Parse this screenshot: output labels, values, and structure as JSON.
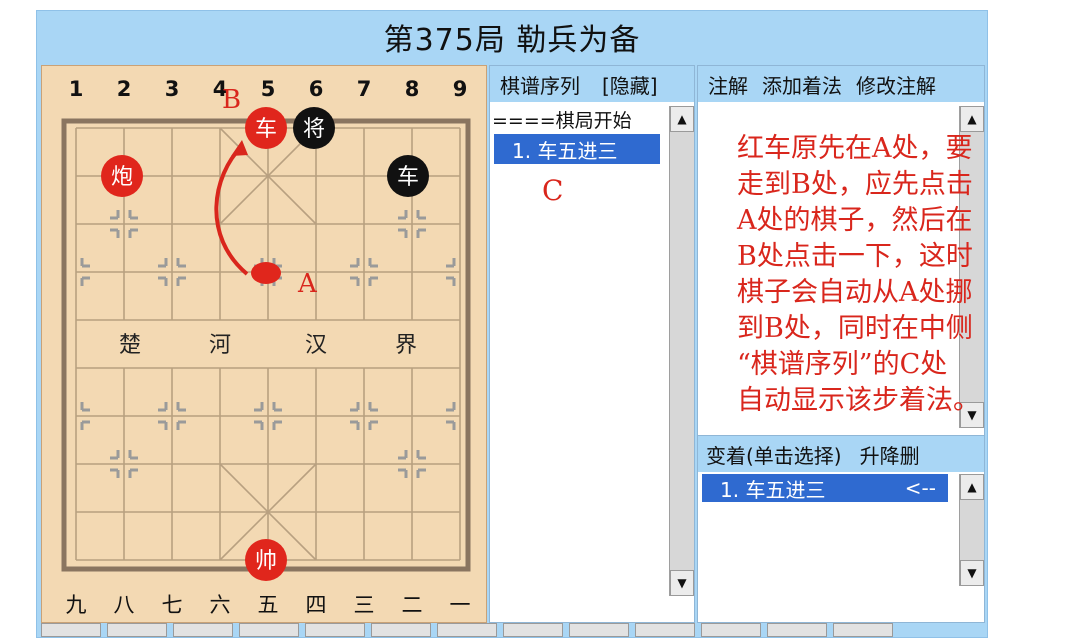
{
  "title": "第375局  勒兵为备",
  "board": {
    "top_numbers": [
      "1",
      "2",
      "3",
      "4",
      "5",
      "6",
      "7",
      "8",
      "9"
    ],
    "bottom_numbers": [
      "九",
      "八",
      "七",
      "六",
      "五",
      "四",
      "三",
      "二",
      "一"
    ],
    "river_text": [
      "楚",
      "河",
      "汉",
      "界"
    ],
    "pieces": [
      {
        "name": "red-chariot",
        "label": "车",
        "side": "red"
      },
      {
        "name": "black-general",
        "label": "将",
        "side": "black"
      },
      {
        "name": "red-cannon",
        "label": "炮",
        "side": "red"
      },
      {
        "name": "black-chariot",
        "label": "车",
        "side": "black"
      },
      {
        "name": "red-marshal",
        "label": "帅",
        "side": "red"
      }
    ],
    "marker_a": "A",
    "marker_b": "B"
  },
  "moves_panel": {
    "header": "棋谱序列",
    "hide_button": "[隐藏]",
    "start_text": "====棋局开始",
    "selected_move": "1. 车五进三",
    "marker_c": "C"
  },
  "notes_panel": {
    "tab_notes": "注解",
    "tab_add_move": "添加着法",
    "tab_edit_notes": "修改注解",
    "annotation_lines": [
      "红车原先在A处，要",
      "走到B处，应先点击",
      "A处的棋子，然后在",
      "B处点击一下，这时",
      "棋子会自动从A处挪",
      "到B处，同时在中侧",
      "“棋谱序列”的C处",
      "自动显示该步着法。"
    ]
  },
  "variations_panel": {
    "header": "变着(单击选择)",
    "header_right": "升降删",
    "selected_move": "1. 车五进三",
    "arrow": "<--"
  },
  "colors": {
    "frame": "#a9d6f5",
    "board": "#f3d9b3",
    "red_piece": "#e0261c",
    "black_piece": "#111111",
    "annotation": "#d9261c",
    "selection": "#2f6ad0"
  }
}
